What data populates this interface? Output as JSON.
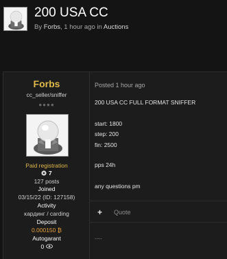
{
  "topic": {
    "title": "200 USA CC",
    "meta_by": "By ",
    "author_link": "Forbs",
    "meta_time": ", 1 hour ago in ",
    "forum_link": "Auctions"
  },
  "author": {
    "name": "Forbs",
    "title": "cc_seller/sniffer",
    "rank_dots": "●●●●",
    "group": "Paid registration",
    "reputation": "7",
    "posts": "127 posts",
    "joined_label": "Joined",
    "joined_value": "03/15/22 (ID: 127158)",
    "activity_label": "Activity",
    "activity_value": "кардинг / carding",
    "deposit_label": "Deposit",
    "deposit_value": "0.000150 ₿",
    "autogarant_label": "Autogarant",
    "autogarant_value": "0"
  },
  "post": {
    "date": "Posted 1 hour ago",
    "lines": [
      "200 USA CC FULL FORMAT SNIFFER",
      "start: 1800",
      "step: 200",
      "fin: 2500",
      "pps 24h",
      "any questions pm"
    ],
    "plus_label": "+",
    "quote_label": "Quote",
    "signature": "....."
  },
  "icons": {
    "reputation": "rep-icon",
    "autogarant": "eye-icon"
  }
}
